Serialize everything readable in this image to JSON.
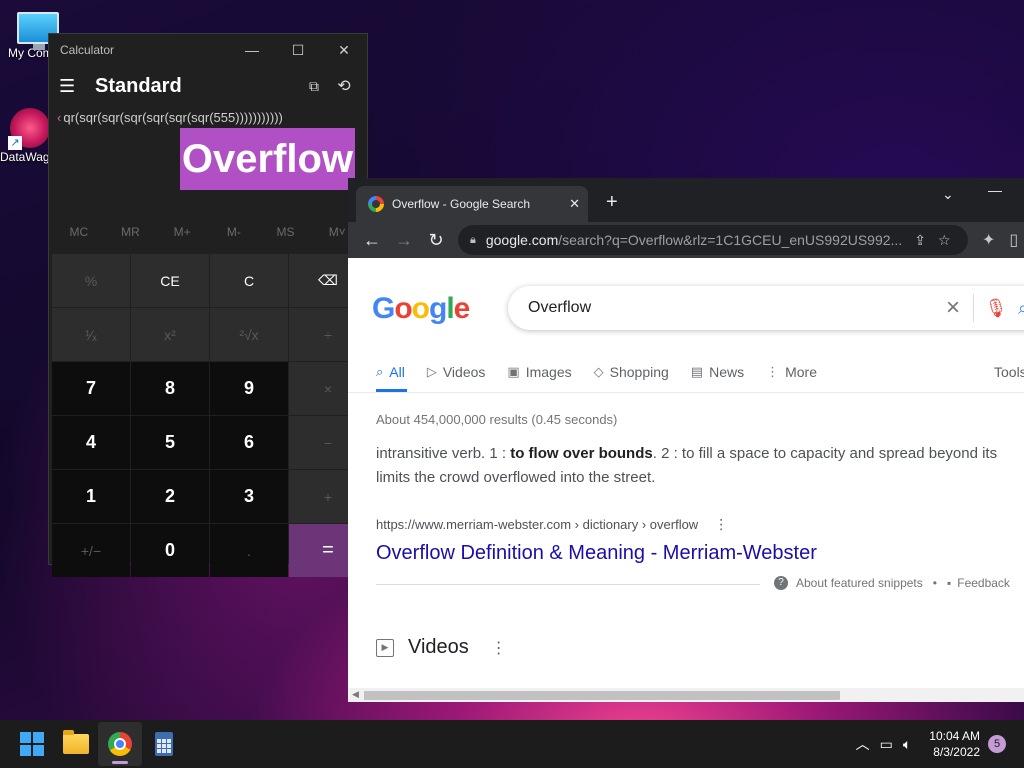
{
  "desktop": {
    "icons": [
      {
        "label": "My Com"
      },
      {
        "label": "DataWag"
      }
    ]
  },
  "calculator": {
    "window_title": "Calculator",
    "mode": "Standard",
    "expression": "qr(sqr(sqr(sqr(sqr(sqr(sqr(555)))))))))))",
    "display": "Overflow",
    "memory": [
      "MC",
      "MR",
      "M+",
      "M-",
      "MS",
      "M˅"
    ],
    "keys": [
      [
        "%",
        "CE",
        "C",
        "⌫"
      ],
      [
        "¹⁄ₓ",
        "x²",
        "²√x",
        "÷"
      ],
      [
        "7",
        "8",
        "9",
        "×"
      ],
      [
        "4",
        "5",
        "6",
        "−"
      ],
      [
        "1",
        "2",
        "3",
        "+"
      ],
      [
        "+/−",
        "0",
        ".",
        "="
      ]
    ],
    "accent_color": "#b14fc4"
  },
  "browser": {
    "tab_title": "Overflow - Google Search",
    "url_host": "google.com",
    "url_path": "/search?q=Overflow&rlz=1C1GCEU_enUS992US992...",
    "search": {
      "query": "Overflow",
      "tabs": [
        "All",
        "Videos",
        "Images",
        "Shopping",
        "News",
        "More"
      ],
      "tools": "Tools",
      "stats": "About 454,000,000 results (0.45 seconds)",
      "snippet_prefix": "intransitive verb. 1 : ",
      "snippet_bold": "to flow over bounds",
      "snippet_rest": ". 2 : to fill a space to capacity and spread beyond its",
      "snippet_line2": "limits the crowd overflowed into the street.",
      "cite": "https://www.merriam-webster.com › dictionary › overflow",
      "result_title": "Overflow Definition & Meaning - Merriam-Webster",
      "about_snippets": "About featured snippets",
      "feedback": "Feedback",
      "videos_heading": "Videos"
    }
  },
  "taskbar": {
    "time": "10:04 AM",
    "date": "8/3/2022",
    "notification_count": "5"
  }
}
